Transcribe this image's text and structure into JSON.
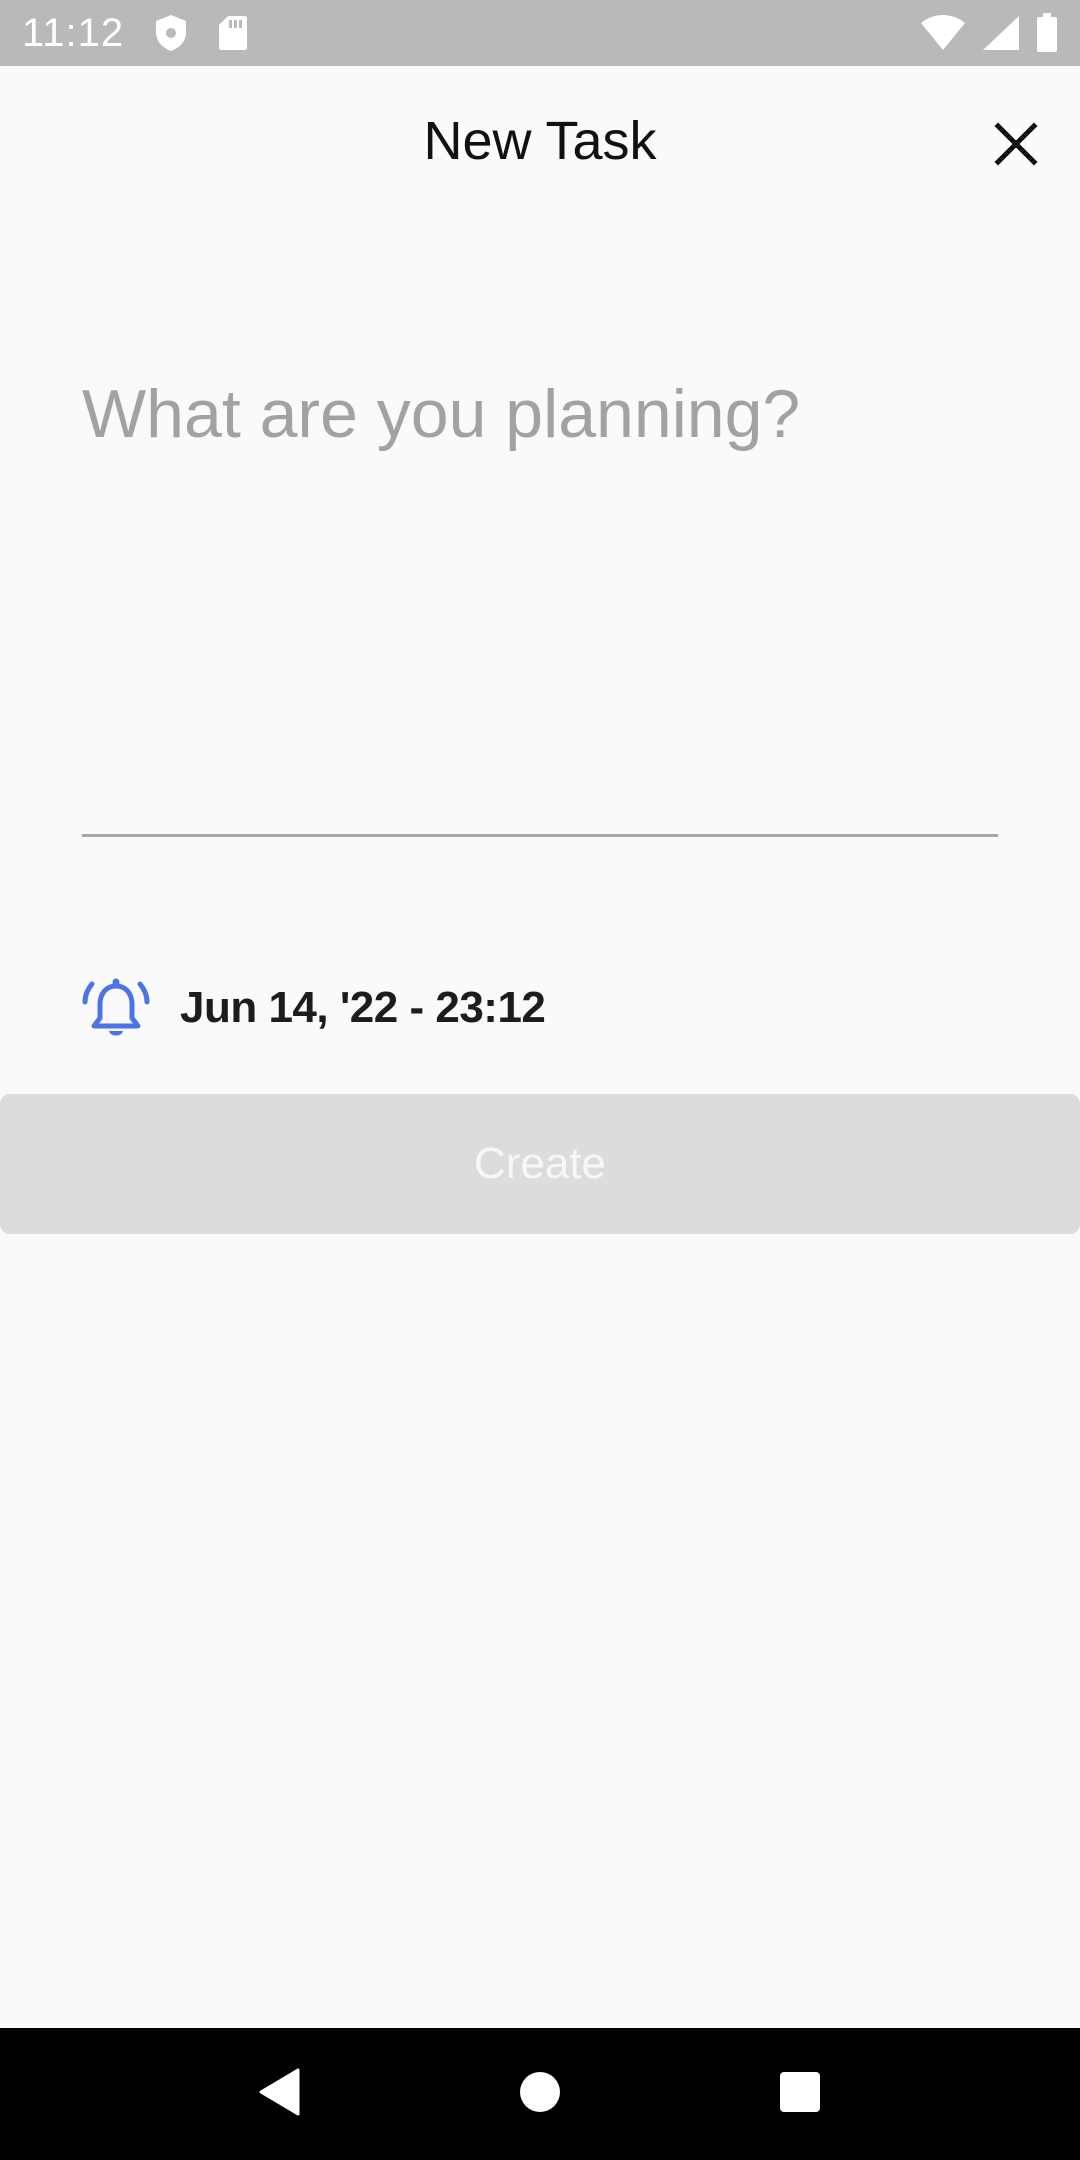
{
  "status_bar": {
    "time": "11:12",
    "icons": [
      "shield-icon",
      "sd-card-icon",
      "wifi-icon",
      "cell-signal-icon",
      "battery-icon"
    ]
  },
  "header": {
    "title": "New Task",
    "close_icon": "close-icon"
  },
  "task_input": {
    "value": "",
    "placeholder": "What are you planning?"
  },
  "reminder": {
    "icon": "alarm-bell-icon",
    "text": "Jun 14, '22 - 23:12",
    "icon_color": "#4a74e8"
  },
  "create_button": {
    "label": "Create",
    "enabled": false
  },
  "nav_bar": {
    "icons": [
      "back-icon",
      "home-icon",
      "recents-icon"
    ]
  }
}
